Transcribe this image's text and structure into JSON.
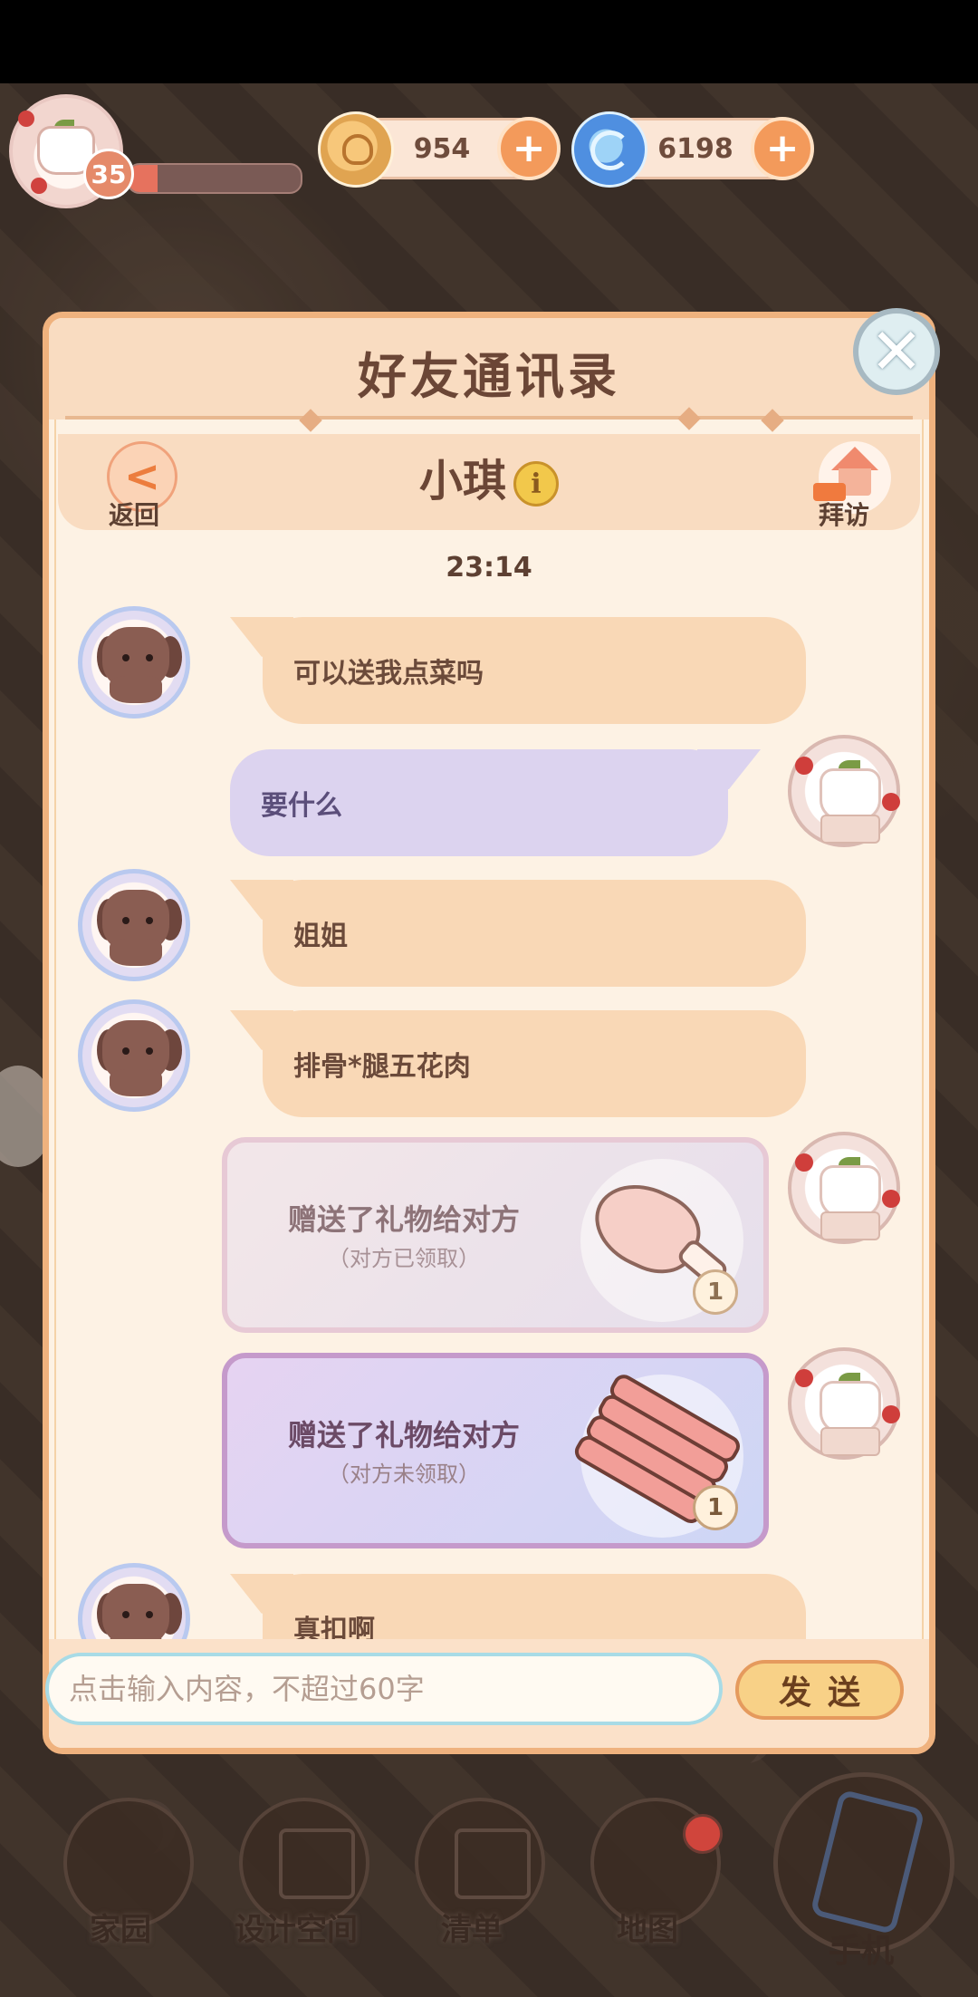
{
  "hud": {
    "level": "35",
    "xp_fraction": 0.17,
    "gold": "954",
    "gems": "6198",
    "plus": "+"
  },
  "panel": {
    "title": "好友通讯录",
    "contact_name": "小琪",
    "info_glyph": "i",
    "back_label": "返回",
    "back_glyph": "<",
    "visit_label": "拜访",
    "close_glyph": "✕"
  },
  "chat": {
    "timestamp": "23:14",
    "messages": [
      {
        "side": "left",
        "text": "可以送我点菜吗"
      },
      {
        "side": "right",
        "text": "要什么"
      },
      {
        "side": "left",
        "text": "姐姐"
      },
      {
        "side": "left",
        "text": "排骨*腿五花肉"
      },
      {
        "side": "right",
        "type": "gift",
        "text": "赠送了礼物给对方",
        "status": "（对方已领取）",
        "count": "1",
        "item_icon": "drumstick-icon"
      },
      {
        "side": "right",
        "type": "gift",
        "text": "赠送了礼物给对方",
        "status": "（对方未领取）",
        "count": "1",
        "item_icon": "ribs-icon"
      },
      {
        "side": "left",
        "text": "真扣啊"
      }
    ]
  },
  "composer": {
    "placeholder": "点击输入内容，不超过60字",
    "send_label": "发送"
  },
  "nav": {
    "items": [
      "家园",
      "设计空间",
      "清单",
      "地图"
    ],
    "phone_label": "手机"
  },
  "colors": {
    "panel_bg": "#fdf2e4",
    "panel_border": "#efb27e",
    "bubble_friend": "#f9d8b6",
    "bubble_self": "#dcd3ef"
  }
}
